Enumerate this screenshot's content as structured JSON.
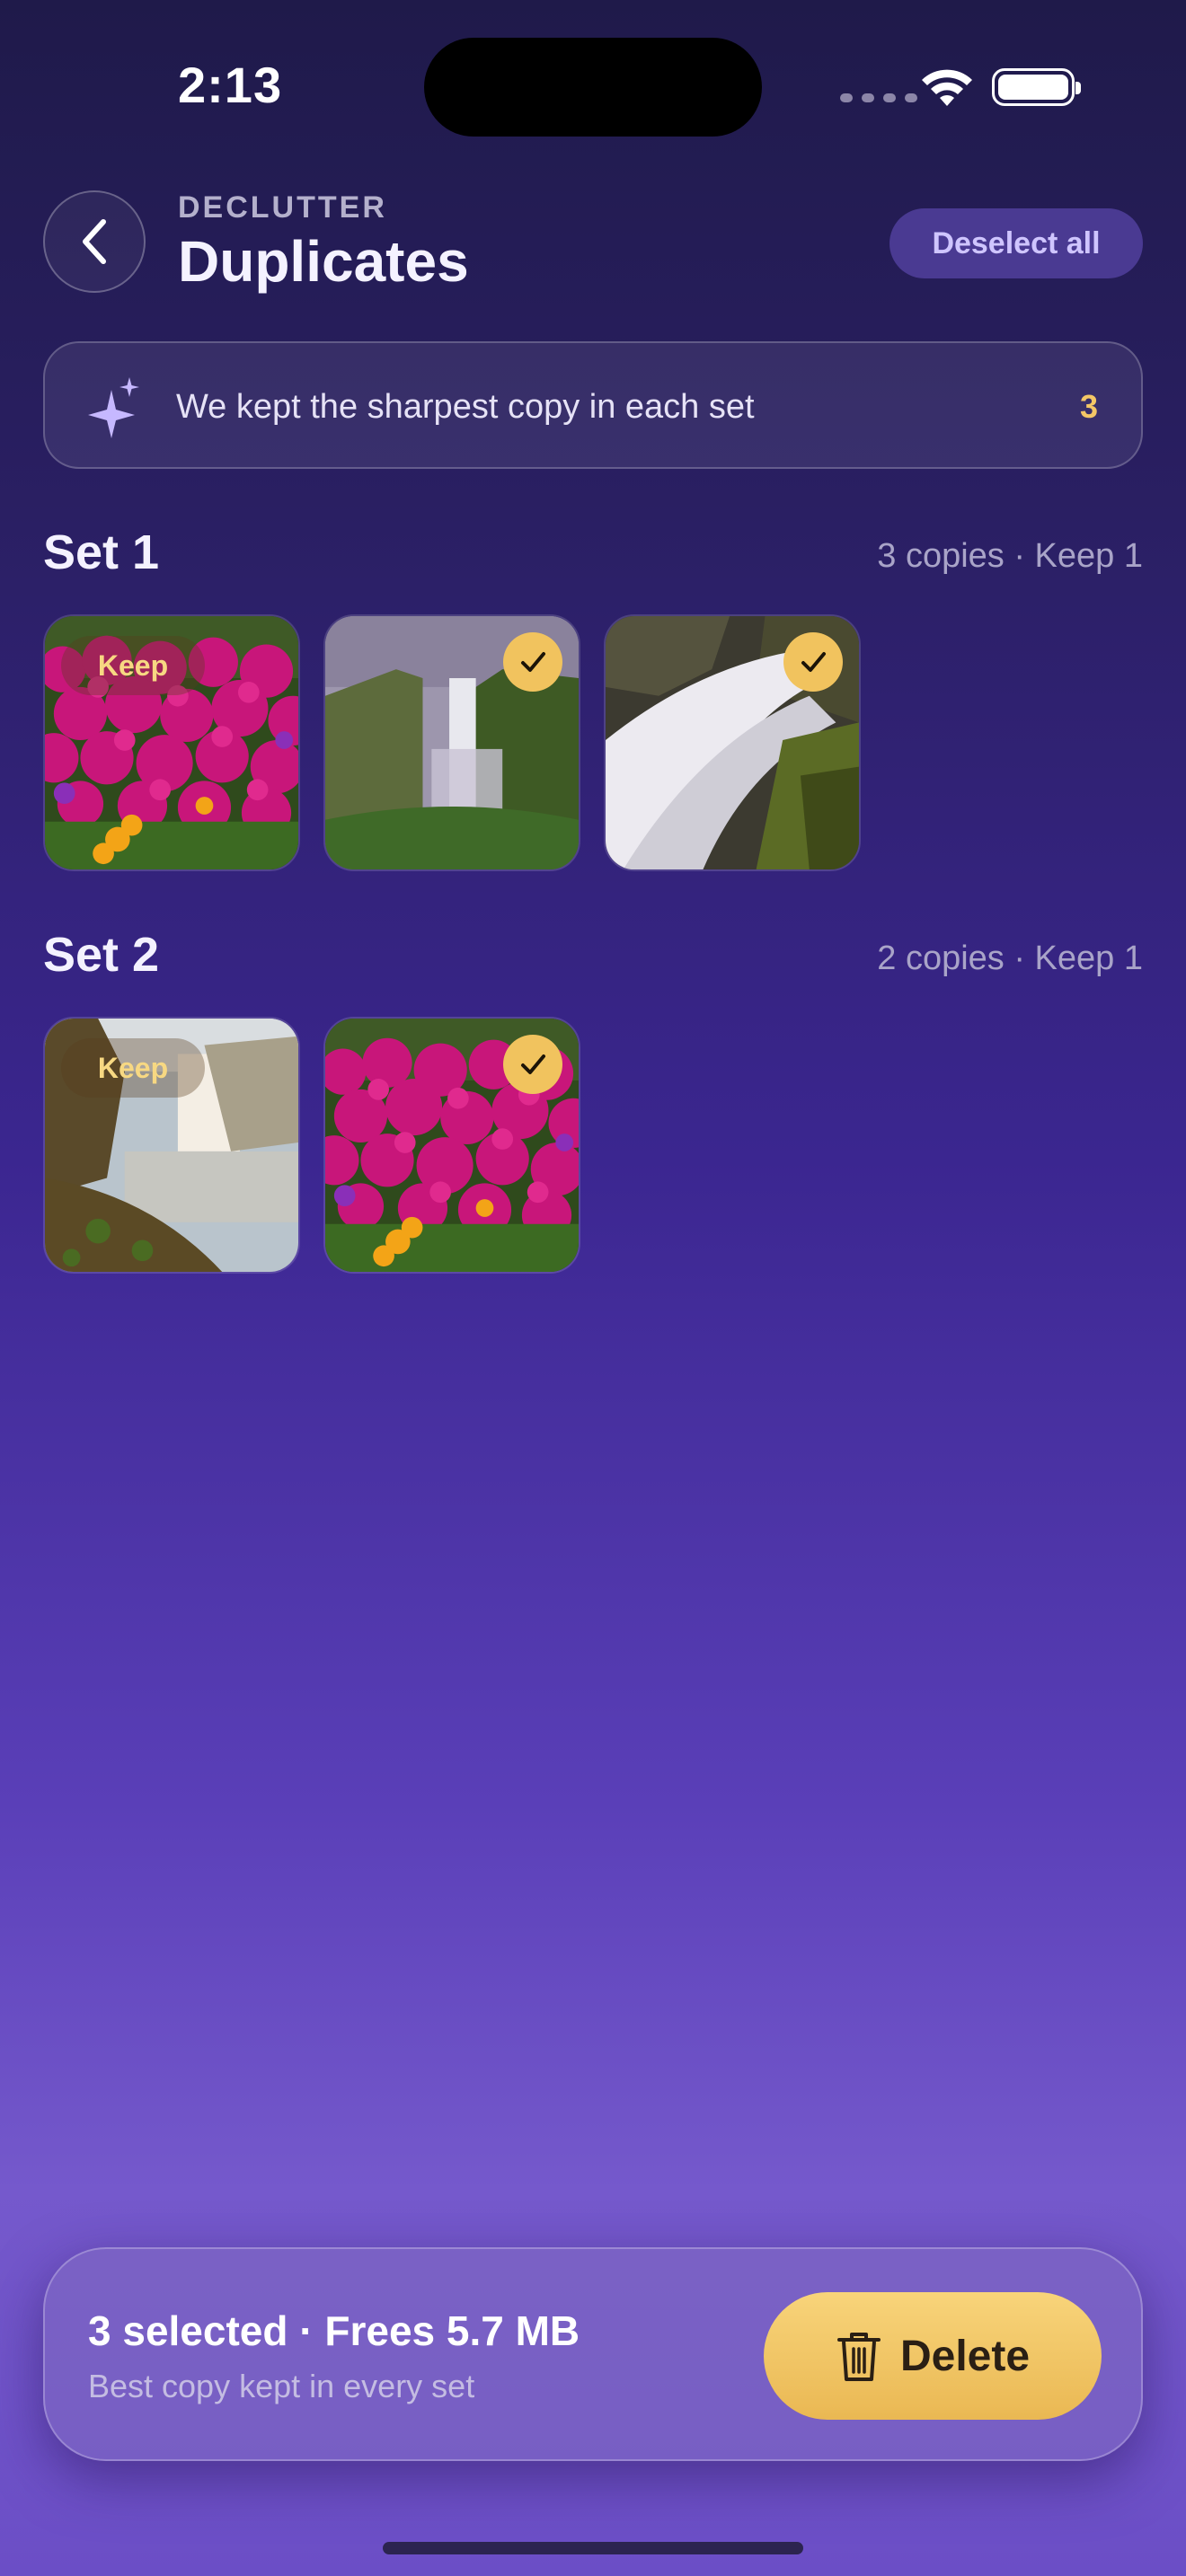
{
  "status_bar": {
    "time": "2:13"
  },
  "header": {
    "eyebrow": "DECLUTTER",
    "title": "Duplicates",
    "deselect_label": "Deselect all"
  },
  "banner": {
    "message": "We kept the sharpest copy in each set",
    "count": "3"
  },
  "sets": [
    {
      "title": "Set 1",
      "meta": "3 copies · Keep 1",
      "photos": [
        {
          "subject": "pink flowers",
          "state": "keep",
          "badge": "Keep"
        },
        {
          "subject": "waterfall valley",
          "state": "selected"
        },
        {
          "subject": "waterfall rocks",
          "state": "selected"
        }
      ]
    },
    {
      "title": "Set 2",
      "meta": "2 copies · Keep 1",
      "photos": [
        {
          "subject": "waterfall cliff",
          "state": "keep",
          "badge": "Keep"
        },
        {
          "subject": "pink flowers",
          "state": "selected"
        }
      ]
    }
  ],
  "bottom_bar": {
    "summary": "3 selected · Frees 5.7 MB",
    "subtitle": "Best copy kept in every set",
    "delete_label": "Delete"
  },
  "colors": {
    "accent": "#f1c35e",
    "keep_text": "#f7d882",
    "deselect_bg": "#4a3a92"
  }
}
